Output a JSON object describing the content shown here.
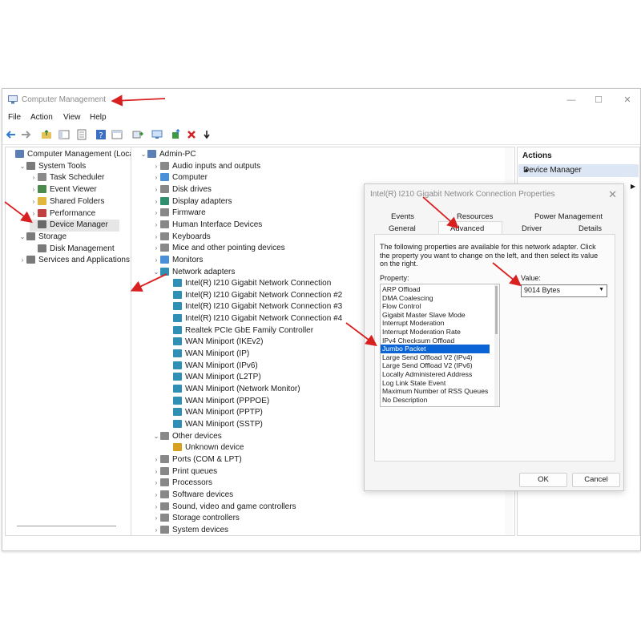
{
  "window": {
    "title": "Computer Management"
  },
  "menu": [
    "File",
    "Action",
    "View",
    "Help"
  ],
  "left_tree": [
    {
      "label": "Computer Management (Local",
      "indent": 0,
      "chev": "",
      "icon": "computer-management-icon",
      "color": "#5b7fb5"
    },
    {
      "label": "System Tools",
      "indent": 1,
      "chev": "v",
      "icon": "system-tools-icon",
      "color": "#7a7a7a"
    },
    {
      "label": "Task Scheduler",
      "indent": 2,
      "chev": ">",
      "icon": "clock-icon",
      "color": "#8a8a8a"
    },
    {
      "label": "Event Viewer",
      "indent": 2,
      "chev": ">",
      "icon": "event-viewer-icon",
      "color": "#4a8a4a"
    },
    {
      "label": "Shared Folders",
      "indent": 2,
      "chev": ">",
      "icon": "folder-icon",
      "color": "#e0b840"
    },
    {
      "label": "Performance",
      "indent": 2,
      "chev": ">",
      "icon": "performance-icon",
      "color": "#c04040"
    },
    {
      "label": "Device Manager",
      "indent": 2,
      "chev": "",
      "icon": "device-manager-icon",
      "color": "#6a6a6a",
      "selected": true
    },
    {
      "label": "Storage",
      "indent": 1,
      "chev": "v",
      "icon": "storage-icon",
      "color": "#7a7a7a"
    },
    {
      "label": "Disk Management",
      "indent": 2,
      "chev": "",
      "icon": "disk-icon",
      "color": "#7a7a7a"
    },
    {
      "label": "Services and Applications",
      "indent": 1,
      "chev": ">",
      "icon": "services-icon",
      "color": "#7a7a7a"
    }
  ],
  "device_tree": [
    {
      "label": "Admin-PC",
      "indent": 0,
      "chev": "v",
      "color": "#5b7fb5"
    },
    {
      "label": "Audio inputs and outputs",
      "indent": 1,
      "chev": ">",
      "color": "#888"
    },
    {
      "label": "Computer",
      "indent": 1,
      "chev": ">",
      "color": "#4a90d9"
    },
    {
      "label": "Disk drives",
      "indent": 1,
      "chev": ">",
      "color": "#888"
    },
    {
      "label": "Display adapters",
      "indent": 1,
      "chev": ">",
      "color": "#2f8f6f"
    },
    {
      "label": "Firmware",
      "indent": 1,
      "chev": ">",
      "color": "#888"
    },
    {
      "label": "Human Interface Devices",
      "indent": 1,
      "chev": ">",
      "color": "#888"
    },
    {
      "label": "Keyboards",
      "indent": 1,
      "chev": ">",
      "color": "#888"
    },
    {
      "label": "Mice and other pointing devices",
      "indent": 1,
      "chev": ">",
      "color": "#888"
    },
    {
      "label": "Monitors",
      "indent": 1,
      "chev": ">",
      "color": "#4a90d9"
    },
    {
      "label": "Network adapters",
      "indent": 1,
      "chev": "v",
      "color": "#2f8fb5"
    },
    {
      "label": "Intel(R) I210 Gigabit Network Connection",
      "indent": 2,
      "chev": "",
      "color": "#2f8fb5"
    },
    {
      "label": "Intel(R) I210 Gigabit Network Connection #2",
      "indent": 2,
      "chev": "",
      "color": "#2f8fb5"
    },
    {
      "label": "Intel(R) I210 Gigabit Network Connection #3",
      "indent": 2,
      "chev": "",
      "color": "#2f8fb5"
    },
    {
      "label": "Intel(R) I210 Gigabit Network Connection #4",
      "indent": 2,
      "chev": "",
      "color": "#2f8fb5"
    },
    {
      "label": "Realtek PCIe GbE Family Controller",
      "indent": 2,
      "chev": "",
      "color": "#2f8fb5"
    },
    {
      "label": "WAN Miniport (IKEv2)",
      "indent": 2,
      "chev": "",
      "color": "#2f8fb5"
    },
    {
      "label": "WAN Miniport (IP)",
      "indent": 2,
      "chev": "",
      "color": "#2f8fb5"
    },
    {
      "label": "WAN Miniport (IPv6)",
      "indent": 2,
      "chev": "",
      "color": "#2f8fb5"
    },
    {
      "label": "WAN Miniport (L2TP)",
      "indent": 2,
      "chev": "",
      "color": "#2f8fb5"
    },
    {
      "label": "WAN Miniport (Network Monitor)",
      "indent": 2,
      "chev": "",
      "color": "#2f8fb5"
    },
    {
      "label": "WAN Miniport (PPPOE)",
      "indent": 2,
      "chev": "",
      "color": "#2f8fb5"
    },
    {
      "label": "WAN Miniport (PPTP)",
      "indent": 2,
      "chev": "",
      "color": "#2f8fb5"
    },
    {
      "label": "WAN Miniport (SSTP)",
      "indent": 2,
      "chev": "",
      "color": "#2f8fb5"
    },
    {
      "label": "Other devices",
      "indent": 1,
      "chev": "v",
      "color": "#888"
    },
    {
      "label": "Unknown device",
      "indent": 2,
      "chev": "",
      "color": "#d9a020"
    },
    {
      "label": "Ports (COM & LPT)",
      "indent": 1,
      "chev": ">",
      "color": "#888"
    },
    {
      "label": "Print queues",
      "indent": 1,
      "chev": ">",
      "color": "#888"
    },
    {
      "label": "Processors",
      "indent": 1,
      "chev": ">",
      "color": "#888"
    },
    {
      "label": "Software devices",
      "indent": 1,
      "chev": ">",
      "color": "#888"
    },
    {
      "label": "Sound, video and game controllers",
      "indent": 1,
      "chev": ">",
      "color": "#888"
    },
    {
      "label": "Storage controllers",
      "indent": 1,
      "chev": ">",
      "color": "#888"
    },
    {
      "label": "System devices",
      "indent": 1,
      "chev": ">",
      "color": "#888"
    }
  ],
  "actions": {
    "header": "Actions",
    "selected": "Device Manager"
  },
  "dialog": {
    "title": "Intel(R) I210 Gigabit Network Connection Properties",
    "tabs_row1": [
      "Events",
      "Resources",
      "Power Management"
    ],
    "tabs_row2": [
      "General",
      "Advanced",
      "Driver",
      "Details"
    ],
    "description": "The following properties are available for this network adapter. Click the property you want to change on the left, and then select its value on the right.",
    "property_label": "Property:",
    "value_label": "Value:",
    "value": "9014 Bytes",
    "properties": [
      "ARP Offload",
      "DMA Coalescing",
      "Flow Control",
      "Gigabit Master Slave Mode",
      "Interrupt Moderation",
      "Interrupt Moderation Rate",
      "IPv4 Checksum Offload",
      "Jumbo Packet",
      "Large Send Offload V2 (IPv4)",
      "Large Send Offload V2 (IPv6)",
      "Locally Administered Address",
      "Log Link State Event",
      "Maximum Number of RSS Queues",
      "No Description"
    ],
    "selected_property": "Jumbo Packet",
    "ok": "OK",
    "cancel": "Cancel"
  },
  "colors": {
    "annotation_arrow": "#d92020",
    "selection": "#0a64d6",
    "actions_highlight": "#dce6f4"
  }
}
